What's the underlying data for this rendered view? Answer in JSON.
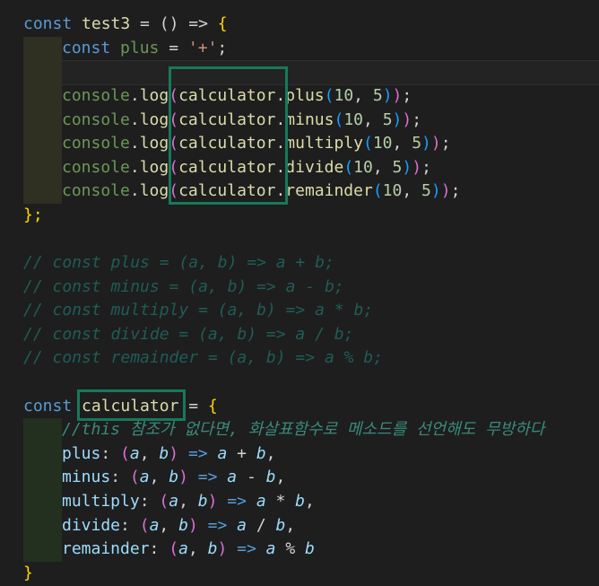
{
  "code": {
    "l1": {
      "kw": "const",
      "name": "test3",
      "eq": " = ",
      "rest": "() => ",
      "brace": "{"
    },
    "l2": {
      "kw": "const",
      "name": "plus",
      "eq": " = ",
      "str": "'+'",
      "semi": ";"
    },
    "l4": {
      "obj": "console",
      "dot": ".",
      "fn": "log",
      "p1": "(",
      "calc": "calculator",
      "dot2": ".",
      "method": "plus",
      "p2": "(",
      "a": "10",
      "comma": ", ",
      "b": "5",
      "p2c": ")",
      "p1c": ")",
      "semi": ";"
    },
    "l5": {
      "obj": "console",
      "dot": ".",
      "fn": "log",
      "p1": "(",
      "calc": "calculator",
      "dot2": ".",
      "method": "minus",
      "p2": "(",
      "a": "10",
      "comma": ", ",
      "b": "5",
      "p2c": ")",
      "p1c": ")",
      "semi": ";"
    },
    "l6": {
      "obj": "console",
      "dot": ".",
      "fn": "log",
      "p1": "(",
      "calc": "calculator",
      "dot2": ".",
      "method": "multiply",
      "p2": "(",
      "a": "10",
      "comma": ", ",
      "b": "5",
      "p2c": ")",
      "p1c": ")",
      "semi": ";"
    },
    "l7": {
      "obj": "console",
      "dot": ".",
      "fn": "log",
      "p1": "(",
      "calc": "calculator",
      "dot2": ".",
      "method": "divide",
      "p2": "(",
      "a": "10",
      "comma": ", ",
      "b": "5",
      "p2c": ")",
      "p1c": ")",
      "semi": ";"
    },
    "l8": {
      "obj": "console",
      "dot": ".",
      "fn": "log",
      "p1": "(",
      "calc": "calculator",
      "dot2": ".",
      "method": "remainder",
      "p2": "(",
      "a": "10",
      "comma": ", ",
      "b": "5",
      "p2c": ")",
      "p1c": ")",
      "semi": ";"
    },
    "l9": "};",
    "c1": "// const plus = (a, b) => a + b;",
    "c2": "// const minus = (a, b) => a - b;",
    "c3": "// const multiply = (a, b) => a * b;",
    "c4": "// const divide = (a, b) => a / b;",
    "c5": "// const remainder = (a, b) => a % b;",
    "l16": {
      "kw": "const",
      "name": "calculator",
      "eq": " = ",
      "brace": "{"
    },
    "l17": "//this 참조가 없다면, 화살표함수로 메소드를 선언해도 무방하다",
    "m1": {
      "key": "plus",
      "colon": ": ",
      "po": "(",
      "a": "a",
      "comma": ", ",
      "b": "b",
      "pc": ")",
      "arrow": " => ",
      "x": "a",
      "op": " + ",
      "y": "b",
      "tail": ","
    },
    "m2": {
      "key": "minus",
      "colon": ": ",
      "po": "(",
      "a": "a",
      "comma": ", ",
      "b": "b",
      "pc": ")",
      "arrow": " => ",
      "x": "a",
      "op": " - ",
      "y": "b",
      "tail": ","
    },
    "m3": {
      "key": "multiply",
      "colon": ": ",
      "po": "(",
      "a": "a",
      "comma": ", ",
      "b": "b",
      "pc": ")",
      "arrow": " => ",
      "x": "a",
      "op": " * ",
      "y": "b",
      "tail": ","
    },
    "m4": {
      "key": "divide",
      "colon": ": ",
      "po": "(",
      "a": "a",
      "comma": ", ",
      "b": "b",
      "pc": ")",
      "arrow": " => ",
      "x": "a",
      "op": " / ",
      "y": "b",
      "tail": ","
    },
    "m5": {
      "key": "remainder",
      "colon": ": ",
      "po": "(",
      "a": "a",
      "comma": ", ",
      "b": "b",
      "pc": ")",
      "arrow": " => ",
      "x": "a",
      "op": " % ",
      "y": "b",
      "tail": ""
    },
    "l23": "}"
  }
}
